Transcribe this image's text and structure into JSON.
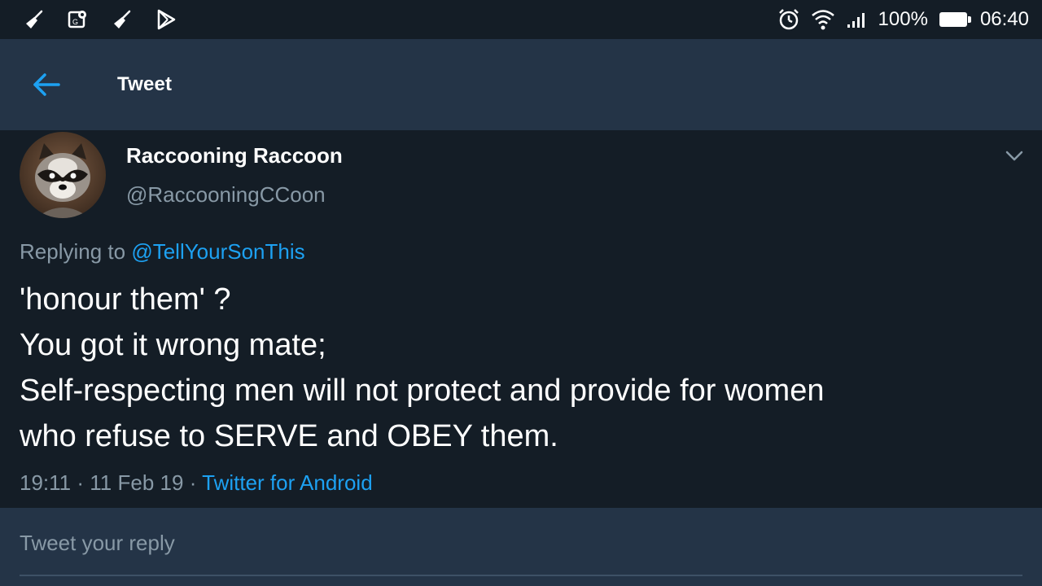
{
  "status_bar": {
    "left_icons": [
      "broom-icon",
      "map-pin-icon",
      "broom-icon",
      "play-store-icon"
    ],
    "signal_bars": 4,
    "battery_percent_text": "100%",
    "battery_level": 1.0,
    "time": "06:40"
  },
  "header": {
    "title": "Tweet",
    "back_icon": "arrow-left-icon"
  },
  "tweet": {
    "author_name": "Raccooning Raccoon",
    "author_handle": "@RaccooningCCoon",
    "replying_prefix": "Replying to",
    "replying_to": "@TellYourSonThis",
    "lines": [
      "'honour them' ?",
      "You got it wrong mate;",
      "Self-respecting men will not protect and provide for women",
      "who refuse to SERVE and OBEY them."
    ],
    "time": "19:11",
    "separator": "·",
    "date": "11 Feb 19",
    "source": "Twitter for Android"
  },
  "reply": {
    "placeholder": "Tweet your reply"
  },
  "colors": {
    "background": "#141d26",
    "header_background": "#243447",
    "accent": "#1da1f2",
    "secondary_text": "#8899a6"
  }
}
